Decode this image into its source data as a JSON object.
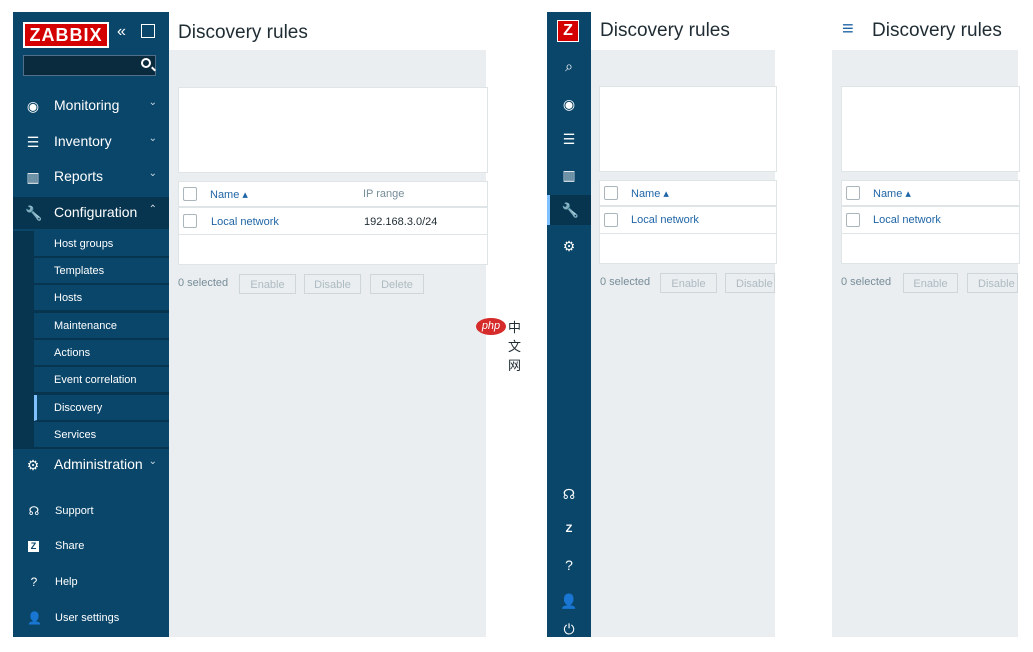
{
  "sidebar": {
    "logo": "ZABBIX",
    "collapse_glyph": "«",
    "menu": [
      {
        "label": "Monitoring",
        "icon": "eye-icon",
        "glyph": "◉"
      },
      {
        "label": "Inventory",
        "icon": "list-icon",
        "glyph": "☰"
      },
      {
        "label": "Reports",
        "icon": "bar-chart-icon",
        "glyph": "▥"
      },
      {
        "label": "Configuration",
        "icon": "wrench-icon",
        "glyph": "🔧"
      },
      {
        "label": "Administration",
        "icon": "gear-icon",
        "glyph": "⚙"
      }
    ],
    "submenu": [
      "Host groups",
      "Templates",
      "Hosts",
      "Maintenance",
      "Actions",
      "Event correlation",
      "Discovery",
      "Services"
    ],
    "bottom": [
      {
        "label": "Support",
        "icon": "headset-icon",
        "glyph": "☊"
      },
      {
        "label": "Share",
        "icon": "zabbix-share-icon",
        "glyph": "Z"
      },
      {
        "label": "Help",
        "icon": "help-icon",
        "glyph": "?"
      },
      {
        "label": "User settings",
        "icon": "user-icon",
        "glyph": "👤"
      }
    ]
  },
  "compact": {
    "logo": "Z",
    "icons": [
      "⌕",
      "◉",
      "☰",
      "▥",
      "🔧",
      "⚙"
    ],
    "bottom_icons": [
      "☊",
      "Z",
      "?",
      "👤",
      "⏻"
    ]
  },
  "page": {
    "title": "Discovery rules",
    "columns": {
      "name": "Name ▴",
      "ip_range": "IP range"
    },
    "rows": [
      {
        "name": "Local network",
        "ip_range": "192.168.3.0/24"
      }
    ],
    "selected_text": "0 selected",
    "buttons": {
      "enable": "Enable",
      "disable": "Disable",
      "delete": "Delete"
    }
  },
  "panel3": {
    "menu_glyph": "≡"
  },
  "watermark": {
    "badge": "php",
    "text": "中文网"
  }
}
